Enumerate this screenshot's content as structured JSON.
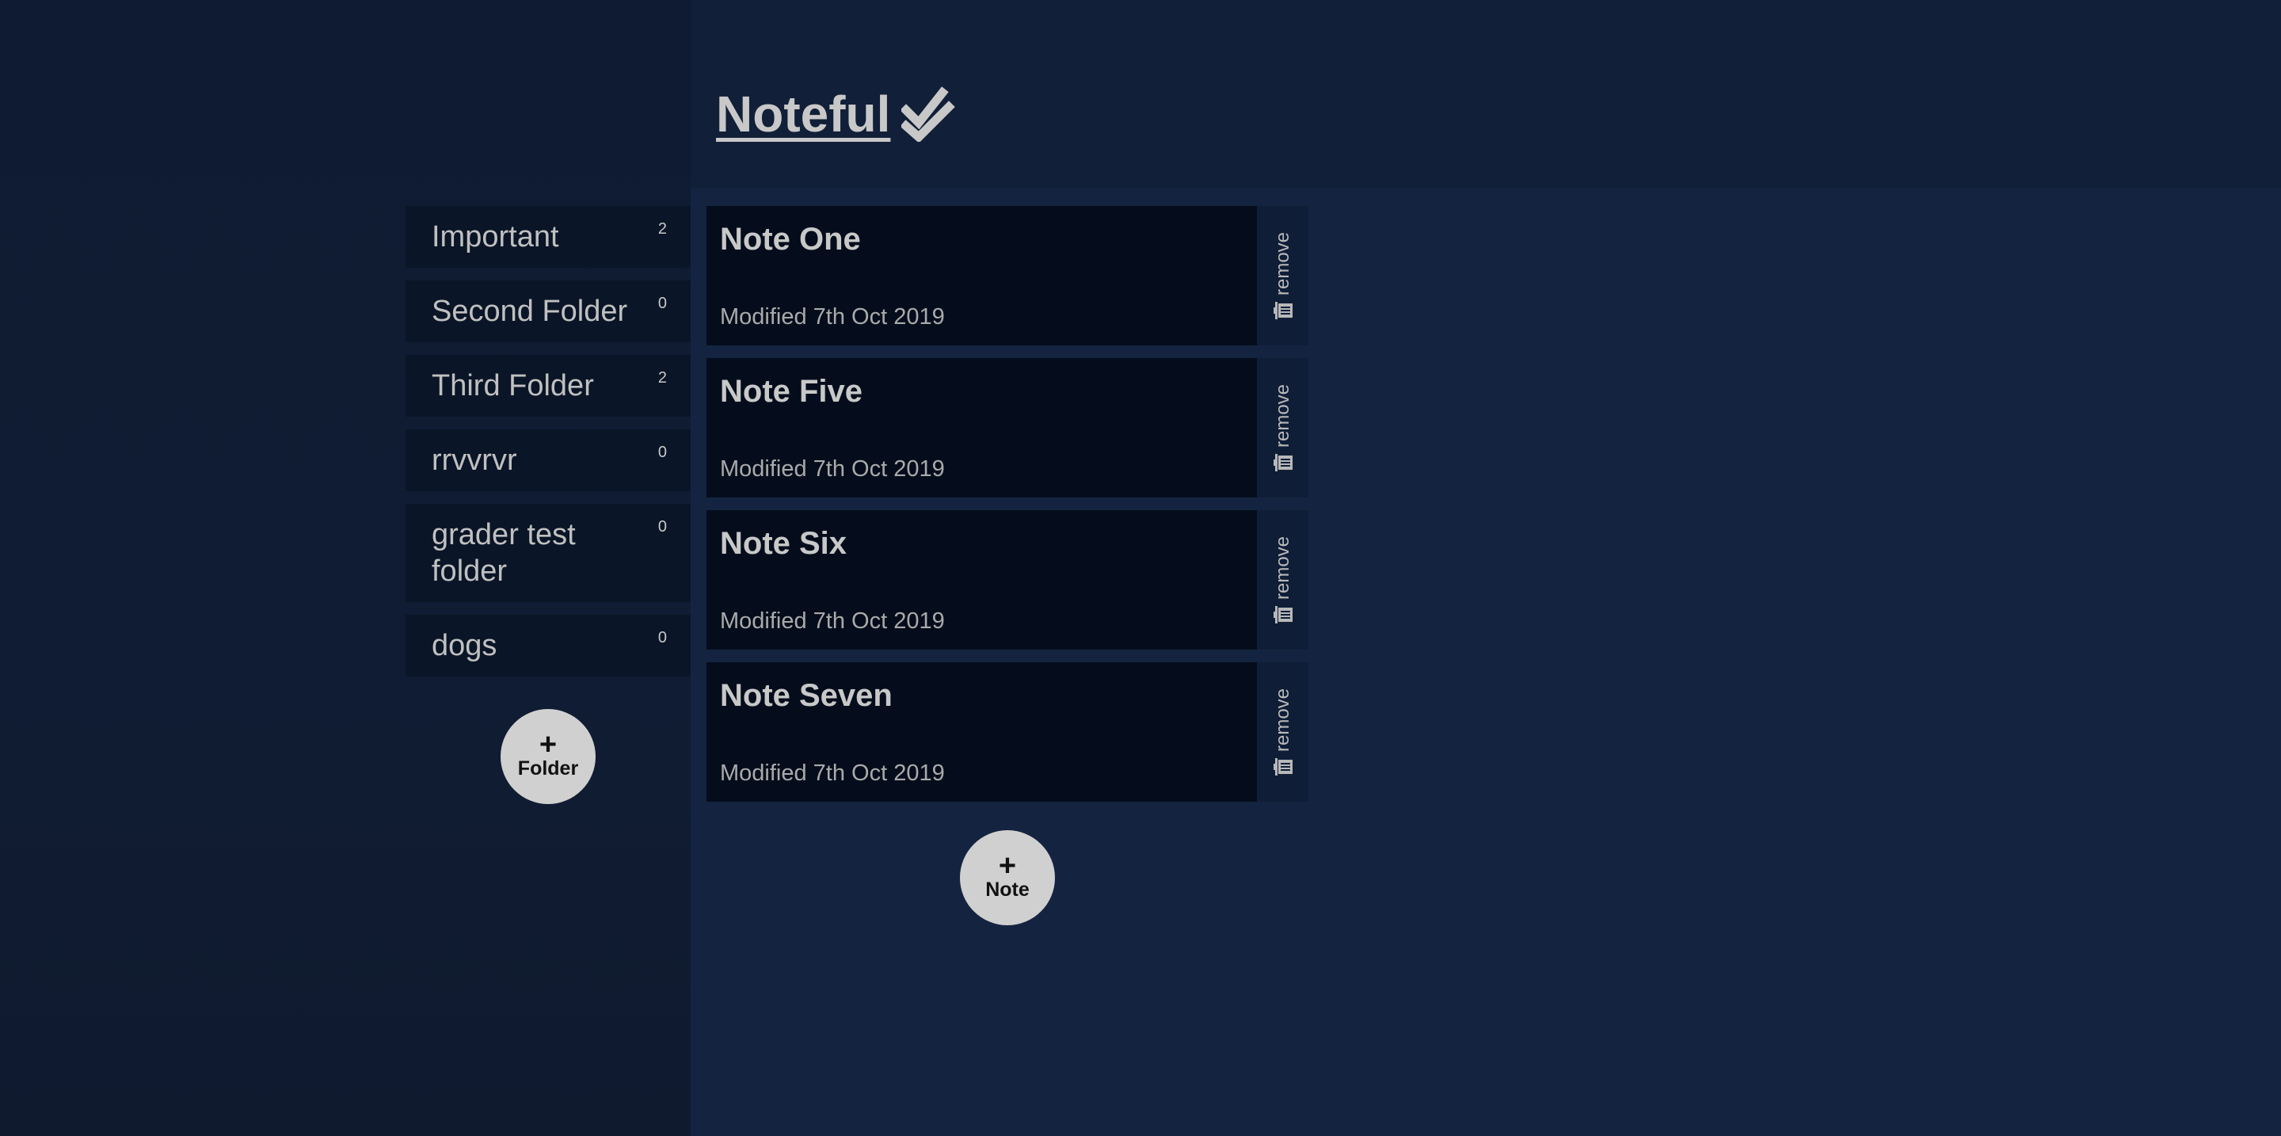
{
  "header": {
    "title": "Noteful",
    "title_icon": "double-check-icon"
  },
  "sidebar": {
    "folders": [
      {
        "name": "Important",
        "count": "2"
      },
      {
        "name": "Second Folder",
        "count": "0"
      },
      {
        "name": "Third Folder",
        "count": "2"
      },
      {
        "name": "rrvvrvr",
        "count": "0"
      },
      {
        "name": "grader test folder",
        "count": "0"
      },
      {
        "name": "dogs",
        "count": "0"
      }
    ],
    "add_button": {
      "plus": "+",
      "label": "Folder"
    }
  },
  "main": {
    "notes": [
      {
        "title": "Note One",
        "modified": "Modified 7th Oct 2019",
        "remove_label": "remove"
      },
      {
        "title": "Note Five",
        "modified": "Modified 7th Oct 2019",
        "remove_label": "remove"
      },
      {
        "title": "Note Six",
        "modified": "Modified 7th Oct 2019",
        "remove_label": "remove"
      },
      {
        "title": "Note Seven",
        "modified": "Modified 7th Oct 2019",
        "remove_label": "remove"
      }
    ],
    "add_button": {
      "plus": "+",
      "label": "Note"
    }
  },
  "colors": {
    "page_background": "#0f1b30",
    "main_background": "#142440",
    "card_background": "#050d1c",
    "folder_background": "#0a1527",
    "button_background": "#d0d0d0",
    "text": "#c8c8c8"
  }
}
